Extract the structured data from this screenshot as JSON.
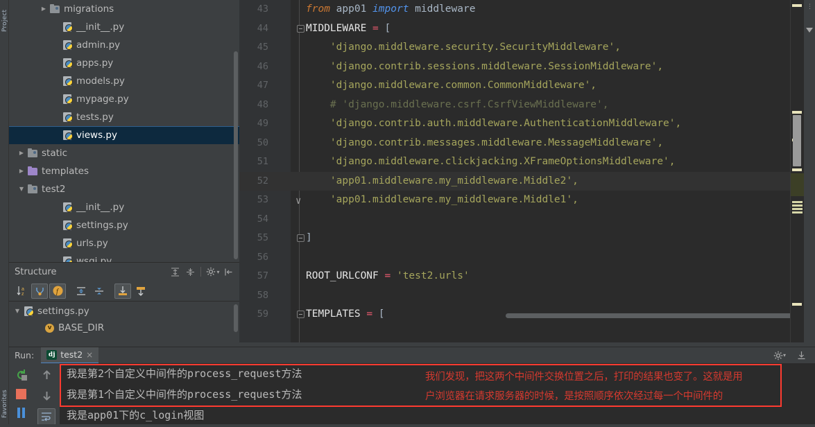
{
  "left_strip": {
    "label_top": "Project",
    "label_bottom": "Favorites"
  },
  "project_tree": [
    {
      "arrow": "▶",
      "icon": "folder-icon",
      "label": "migrations",
      "indent": 60,
      "selected": false
    },
    {
      "arrow": "",
      "icon": "python-file-icon",
      "label": "__init__.py",
      "indent": 78,
      "selected": false
    },
    {
      "arrow": "",
      "icon": "python-file-icon",
      "label": "admin.py",
      "indent": 78,
      "selected": false
    },
    {
      "arrow": "",
      "icon": "python-file-icon",
      "label": "apps.py",
      "indent": 78,
      "selected": false
    },
    {
      "arrow": "",
      "icon": "python-file-icon",
      "label": "models.py",
      "indent": 78,
      "selected": false
    },
    {
      "arrow": "",
      "icon": "python-file-icon",
      "label": "mypage.py",
      "indent": 78,
      "selected": false
    },
    {
      "arrow": "",
      "icon": "python-file-icon",
      "label": "tests.py",
      "indent": 78,
      "selected": false
    },
    {
      "arrow": "",
      "icon": "python-file-icon",
      "label": "views.py",
      "indent": 78,
      "selected": true
    },
    {
      "arrow": "▶",
      "icon": "folder-icon",
      "label": "static",
      "indent": 28,
      "selected": false
    },
    {
      "arrow": "▶",
      "icon": "folder-purple-icon",
      "label": "templates",
      "indent": 28,
      "selected": false
    },
    {
      "arrow": "▼",
      "icon": "folder-icon",
      "label": "test2",
      "indent": 28,
      "selected": false
    },
    {
      "arrow": "",
      "icon": "python-file-icon",
      "label": "__init__.py",
      "indent": 78,
      "selected": false
    },
    {
      "arrow": "",
      "icon": "python-file-icon",
      "label": "settings.py",
      "indent": 78,
      "selected": false
    },
    {
      "arrow": "",
      "icon": "python-file-icon",
      "label": "urls.py",
      "indent": 78,
      "selected": false
    },
    {
      "arrow": "",
      "icon": "python-file-icon",
      "label": "wsgi.py",
      "indent": 78,
      "selected": false
    }
  ],
  "structure": {
    "title": "Structure",
    "header_icons": [
      "expand-all-icon",
      "collapse-all-icon",
      "gear-icon",
      "hide-panel-icon"
    ],
    "toolbar": [
      {
        "name": "sort-alphabetically-icon",
        "glyph": "↓a₂",
        "active": false
      },
      {
        "name": "show-fields-icon",
        "glyph": "⑂",
        "active": true
      },
      {
        "name": "show-properties-icon",
        "glyph": "f",
        "active": true
      },
      {
        "name": "expand-all-icon",
        "glyph": "⇕",
        "active": false
      },
      {
        "name": "collapse-all-icon",
        "glyph": "⇵",
        "active": false
      },
      {
        "name": "autoscroll-to-source-icon",
        "glyph": "⤓",
        "active": true
      },
      {
        "name": "autoscroll-from-source-icon",
        "glyph": "↓",
        "active": false
      }
    ],
    "rows": [
      {
        "arrow": "▼",
        "icon": "python-file-icon",
        "label": "settings.py",
        "indent": 14
      },
      {
        "arrow": "",
        "icon": "variable-badge-icon",
        "badge": "v",
        "label": "BASE_DIR",
        "indent": 48
      }
    ]
  },
  "editor": {
    "lines": [
      {
        "num": "43",
        "fold": "",
        "tokens": [
          {
            "t": "from ",
            "c": "kw"
          },
          {
            "t": "app01 ",
            "c": "txt"
          },
          {
            "t": "import ",
            "c": "kw2"
          },
          {
            "t": "middleware",
            "c": "txt"
          }
        ]
      },
      {
        "num": "44",
        "fold": "start",
        "tokens": [
          {
            "t": "MIDDLEWARE ",
            "c": "white"
          },
          {
            "t": "=",
            "c": "op"
          },
          {
            "t": " [",
            "c": "txt"
          }
        ]
      },
      {
        "num": "45",
        "fold": "",
        "tokens": [
          {
            "t": "    'django.middleware.security.SecurityMiddleware',",
            "c": "str"
          }
        ]
      },
      {
        "num": "46",
        "fold": "",
        "tokens": [
          {
            "t": "    'django.contrib.sessions.middleware.SessionMiddleware',",
            "c": "str"
          }
        ]
      },
      {
        "num": "47",
        "fold": "",
        "tokens": [
          {
            "t": "    'django.middleware.common.CommonMiddleware',",
            "c": "str"
          }
        ]
      },
      {
        "num": "48",
        "fold": "",
        "tokens": [
          {
            "t": "    # 'django.middleware.csrf.CsrfViewMiddleware',",
            "c": "cmt"
          }
        ]
      },
      {
        "num": "49",
        "fold": "",
        "tokens": [
          {
            "t": "    'django.contrib.auth.middleware.AuthenticationMiddleware',",
            "c": "str"
          }
        ]
      },
      {
        "num": "50",
        "fold": "",
        "tokens": [
          {
            "t": "    'django.contrib.messages.middleware.MessageMiddleware',",
            "c": "str"
          }
        ]
      },
      {
        "num": "51",
        "fold": "",
        "tokens": [
          {
            "t": "    'django.middleware.clickjacking.XFrameOptionsMiddleware',",
            "c": "str"
          }
        ]
      },
      {
        "num": "52",
        "fold": "",
        "current": true,
        "tokens": [
          {
            "t": "    'app01.middleware.my_middleware.Middle2',",
            "c": "str"
          }
        ]
      },
      {
        "num": "53",
        "fold": "check",
        "tokens": [
          {
            "t": "    'app01.middleware.my_middleware.Middle1',",
            "c": "str"
          }
        ]
      },
      {
        "num": "54",
        "fold": "",
        "tokens": [
          {
            "t": "",
            "c": "txt"
          }
        ]
      },
      {
        "num": "55",
        "fold": "end",
        "tokens": [
          {
            "t": "]",
            "c": "txt"
          }
        ]
      },
      {
        "num": "56",
        "fold": "",
        "tokens": [
          {
            "t": "",
            "c": "txt"
          }
        ]
      },
      {
        "num": "57",
        "fold": "",
        "tokens": [
          {
            "t": "ROOT_URLCONF ",
            "c": "white"
          },
          {
            "t": "=",
            "c": "op"
          },
          {
            "t": " ",
            "c": "txt"
          },
          {
            "t": "'test2.urls'",
            "c": "str"
          }
        ]
      },
      {
        "num": "58",
        "fold": "",
        "tokens": [
          {
            "t": "",
            "c": "txt"
          }
        ]
      },
      {
        "num": "59",
        "fold": "start",
        "tokens": [
          {
            "t": "TEMPLATES ",
            "c": "white"
          },
          {
            "t": "=",
            "c": "op"
          },
          {
            "t": " [",
            "c": "txt"
          }
        ]
      }
    ]
  },
  "run_panel": {
    "label": "Run:",
    "tab_label": "test2",
    "tab_icon": "django-icon",
    "tab_icon_text": "dj",
    "close_label": "×",
    "header_icons": [
      "gear-icon",
      "export-icon"
    ],
    "toolbar": [
      {
        "name": "rerun-button",
        "glyph": "↻"
      },
      {
        "name": "stop-button",
        "glyph": "■"
      },
      {
        "name": "pause-button",
        "glyph": "‖"
      }
    ],
    "toolbar2": [
      {
        "name": "scroll-up-button",
        "glyph": "↑"
      },
      {
        "name": "scroll-down-button",
        "glyph": "↓"
      },
      {
        "name": "soft-wrap-button",
        "glyph": "≡"
      }
    ],
    "console_lines": [
      "我是第2个自定义中间件的process_request方法",
      "我是第1个自定义中间件的process_request方法",
      "我是app01下的c_login视图"
    ],
    "red_annotation": [
      "我们发现，把这两个中间件交换位置之后，打印的结果也变了。这就是用",
      "户浏览器在请求服务器的时候，是按照顺序依次经过每一个中间件的"
    ]
  },
  "colors": {
    "panel_bg": "#3c3f41",
    "editor_bg": "#2b2b2b",
    "selection": "#0d293e",
    "string": "#a5a55c",
    "comment": "#6a7050",
    "keyword": "#cc7832",
    "operator": "#e8596e",
    "red_annotation": "#d63a2f",
    "red_box": "#ff3b30"
  }
}
